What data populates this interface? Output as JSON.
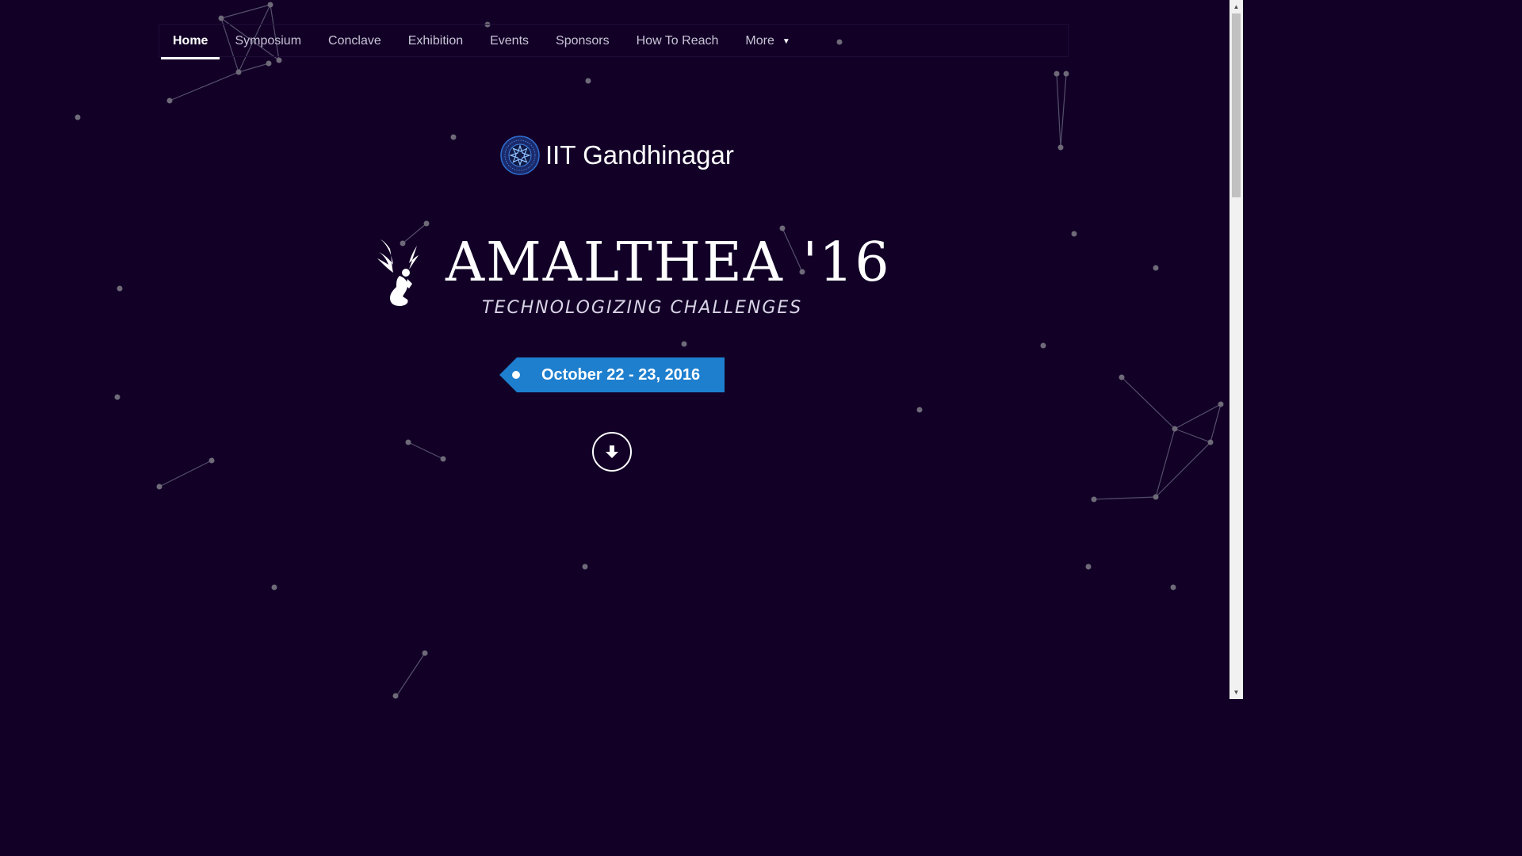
{
  "nav": {
    "items": [
      {
        "label": "Home",
        "active": true
      },
      {
        "label": "Symposium",
        "active": false
      },
      {
        "label": "Conclave",
        "active": false
      },
      {
        "label": "Exhibition",
        "active": false
      },
      {
        "label": "Events",
        "active": false
      },
      {
        "label": "Sponsors",
        "active": false
      },
      {
        "label": "How To Reach",
        "active": false
      }
    ],
    "more_label": "More"
  },
  "brand": {
    "name": "IIT Gandhinagar",
    "logo_icon": "iitgn-emblem-icon"
  },
  "hero": {
    "title": "AMALTHEA '16",
    "tagline": "TECHNOLOGIZING CHALLENGES",
    "mascot_icon": "winged-thinker-icon",
    "date": "October 22 - 23, 2016",
    "scroll_icon": "arrow-down-icon"
  },
  "colors": {
    "background": "#120027",
    "accent": "#1e7fce",
    "text": "#ffffff",
    "particle": "#6e6a78"
  }
}
